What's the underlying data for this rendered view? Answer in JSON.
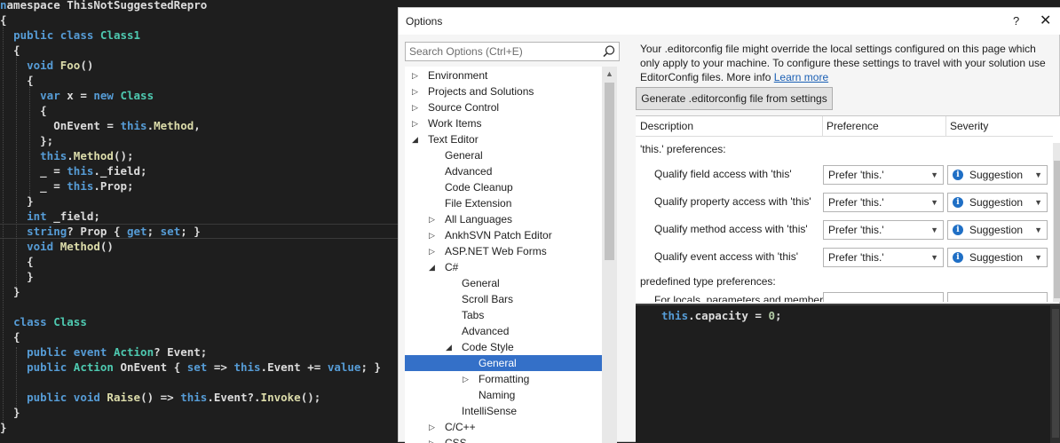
{
  "editor": {
    "lines": [
      [
        [
          "kw",
          "n"
        ],
        [
          "pr",
          "amespace ThisNotSuggestedRepro"
        ]
      ],
      [
        [
          "pr",
          "{"
        ]
      ],
      [
        [
          "pr",
          "  "
        ],
        [
          "kw",
          "public class "
        ],
        [
          "ty",
          "Class1"
        ]
      ],
      [
        [
          "pr",
          "  {"
        ]
      ],
      [
        [
          "pr",
          "    "
        ],
        [
          "kw",
          "void "
        ],
        [
          "fn",
          "Foo"
        ],
        [
          "pr",
          "()"
        ]
      ],
      [
        [
          "pr",
          "    {"
        ]
      ],
      [
        [
          "pr",
          "      "
        ],
        [
          "kw",
          "var "
        ],
        [
          "pr",
          "x = "
        ],
        [
          "kw",
          "new "
        ],
        [
          "ty",
          "Class"
        ]
      ],
      [
        [
          "pr",
          "      {"
        ]
      ],
      [
        [
          "pr",
          "        OnEvent = "
        ],
        [
          "kw",
          "this"
        ],
        [
          "pr",
          "."
        ],
        [
          "fn",
          "Method"
        ],
        [
          "pr",
          ","
        ]
      ],
      [
        [
          "pr",
          "      };"
        ]
      ],
      [
        [
          "pr",
          "      "
        ],
        [
          "kw",
          "this"
        ],
        [
          "pr",
          "."
        ],
        [
          "fn",
          "Method"
        ],
        [
          "pr",
          "();"
        ]
      ],
      [
        [
          "pr",
          "      _ = "
        ],
        [
          "kw",
          "this"
        ],
        [
          "pr",
          "._field;"
        ]
      ],
      [
        [
          "pr",
          "      _ = "
        ],
        [
          "kw",
          "this"
        ],
        [
          "pr",
          ".Prop;"
        ]
      ],
      [
        [
          "pr",
          "    }"
        ]
      ],
      [
        [
          "pr",
          "    "
        ],
        [
          "kw",
          "int "
        ],
        [
          "pr",
          "_field;"
        ]
      ],
      [
        [
          "pr",
          "    "
        ],
        [
          "kw",
          "string"
        ],
        [
          "pr",
          "? Prop { "
        ],
        [
          "kw",
          "get"
        ],
        [
          "pr",
          "; "
        ],
        [
          "kw",
          "set"
        ],
        [
          "pr",
          "; }"
        ]
      ],
      [
        [
          "pr",
          "    "
        ],
        [
          "kw",
          "void "
        ],
        [
          "fn",
          "Method"
        ],
        [
          "pr",
          "()"
        ]
      ],
      [
        [
          "pr",
          "    {"
        ]
      ],
      [
        [
          "pr",
          "    }"
        ]
      ],
      [
        [
          "pr",
          "  }"
        ]
      ],
      [
        [
          "pr",
          ""
        ]
      ],
      [
        [
          "pr",
          "  "
        ],
        [
          "kw",
          "class "
        ],
        [
          "ty",
          "Class"
        ]
      ],
      [
        [
          "pr",
          "  {"
        ]
      ],
      [
        [
          "pr",
          "    "
        ],
        [
          "kw",
          "public event "
        ],
        [
          "ty",
          "Action"
        ],
        [
          "pr",
          "? Event;"
        ]
      ],
      [
        [
          "pr",
          "    "
        ],
        [
          "kw",
          "public "
        ],
        [
          "ty",
          "Action "
        ],
        [
          "pr",
          "OnEvent { "
        ],
        [
          "kw",
          "set "
        ],
        [
          "pr",
          "=> "
        ],
        [
          "kw",
          "this"
        ],
        [
          "pr",
          ".Event += "
        ],
        [
          "kw",
          "value"
        ],
        [
          "pr",
          "; }"
        ]
      ],
      [
        [
          "pr",
          ""
        ]
      ],
      [
        [
          "pr",
          "    "
        ],
        [
          "kw",
          "public void "
        ],
        [
          "fn",
          "Raise"
        ],
        [
          "pr",
          "() => "
        ],
        [
          "kw",
          "this"
        ],
        [
          "pr",
          ".Event?."
        ],
        [
          "fn",
          "Invoke"
        ],
        [
          "pr",
          "();"
        ]
      ],
      [
        [
          "pr",
          "  }"
        ]
      ],
      [
        [
          "pr",
          "}"
        ]
      ]
    ]
  },
  "dialog": {
    "title": "Options",
    "help": "?",
    "close": "✕",
    "search_placeholder": "Search Options (Ctrl+E)",
    "tree": [
      {
        "label": "Environment",
        "level": 0,
        "arrow": "▷"
      },
      {
        "label": "Projects and Solutions",
        "level": 0,
        "arrow": "▷"
      },
      {
        "label": "Source Control",
        "level": 0,
        "arrow": "▷"
      },
      {
        "label": "Work Items",
        "level": 0,
        "arrow": "▷"
      },
      {
        "label": "Text Editor",
        "level": 0,
        "arrow": "◢"
      },
      {
        "label": "General",
        "level": 1,
        "arrow": ""
      },
      {
        "label": "Advanced",
        "level": 1,
        "arrow": ""
      },
      {
        "label": "Code Cleanup",
        "level": 1,
        "arrow": ""
      },
      {
        "label": "File Extension",
        "level": 1,
        "arrow": ""
      },
      {
        "label": "All Languages",
        "level": 1,
        "arrow": "▷"
      },
      {
        "label": "AnkhSVN Patch Editor",
        "level": 1,
        "arrow": "▷"
      },
      {
        "label": "ASP.NET Web Forms",
        "level": 1,
        "arrow": "▷"
      },
      {
        "label": "C#",
        "level": 1,
        "arrow": "◢"
      },
      {
        "label": "General",
        "level": 2,
        "arrow": ""
      },
      {
        "label": "Scroll Bars",
        "level": 2,
        "arrow": ""
      },
      {
        "label": "Tabs",
        "level": 2,
        "arrow": ""
      },
      {
        "label": "Advanced",
        "level": 2,
        "arrow": ""
      },
      {
        "label": "Code Style",
        "level": 2,
        "arrow": "◢"
      },
      {
        "label": "General",
        "level": 3,
        "arrow": "",
        "selected": true
      },
      {
        "label": "Formatting",
        "level": 3,
        "arrow": "▷"
      },
      {
        "label": "Naming",
        "level": 3,
        "arrow": ""
      },
      {
        "label": "IntelliSense",
        "level": 2,
        "arrow": ""
      },
      {
        "label": "C/C++",
        "level": 1,
        "arrow": "▷"
      },
      {
        "label": "CSS",
        "level": 1,
        "arrow": "▷"
      }
    ],
    "info_text": "Your .editorconfig file might override the local settings configured on this page which only apply to your machine. To configure these settings to travel with your solution use EditorConfig files. More info",
    "learn_more": "Learn more",
    "generate_button": "Generate .editorconfig file from settings",
    "grid": {
      "columns": [
        "Description",
        "Preference",
        "Severity"
      ],
      "group1": "'this.' preferences:",
      "rows": [
        {
          "label": "Qualify field access with 'this'",
          "preference": "Prefer 'this.'",
          "severity": "Suggestion"
        },
        {
          "label": "Qualify property access with 'this'",
          "preference": "Prefer 'this.'",
          "severity": "Suggestion"
        },
        {
          "label": "Qualify method access with 'this'",
          "preference": "Prefer 'this.'",
          "severity": "Suggestion"
        },
        {
          "label": "Qualify event access with 'this'",
          "preference": "Prefer 'this.'",
          "severity": "Suggestion"
        }
      ],
      "group2": "predefined type preferences:",
      "partial_row": "For locals, parameters and members"
    },
    "preview": [
      [
        "kw",
        "this"
      ],
      [
        "pr",
        "."
      ],
      [
        "pr",
        "capacity = "
      ],
      [
        "nu",
        "0"
      ],
      [
        "pr",
        ";"
      ]
    ]
  }
}
